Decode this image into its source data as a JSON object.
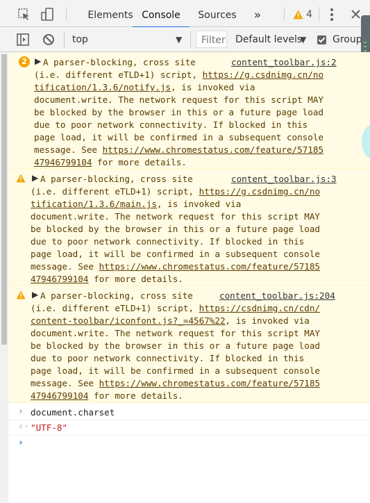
{
  "tabs": [
    {
      "label": "Elements"
    },
    {
      "label": "Console"
    },
    {
      "label": "Sources"
    }
  ],
  "tabs_more": "»",
  "warning_count": "4",
  "toolbar": {
    "context": "top",
    "filter_placeholder": "Filter",
    "levels": "Default levels",
    "group_label": "Group"
  },
  "messages": [
    {
      "count": "2",
      "source": "content_toolbar.js:2",
      "lines": [
        "A parser-blocking, cross site",
        "(i.e. different eTLD+1) script, ",
        "tification/1.3.6/notify.js",
        ", is invoked via",
        "document.write. The network request for this script MAY",
        "be blocked by the browser in this or a future page load",
        "due to poor network connectivity. If blocked in this",
        "page load, it will be confirmed in a subsequent console",
        "message. See ",
        "47946799104",
        " for more details."
      ],
      "url1a": "https://g.csdnimg.cn/no",
      "url2a": "https://www.chromestatus.com/feature/57185"
    },
    {
      "source": "content_toolbar.js:3",
      "lines": [
        "A parser-blocking, cross site",
        "(i.e. different eTLD+1) script, ",
        "tification/1.3.6/main.js",
        ", is invoked via",
        "document.write. The network request for this script MAY",
        "be blocked by the browser in this or a future page load",
        "due to poor network connectivity. If blocked in this",
        "page load, it will be confirmed in a subsequent console",
        "message. See ",
        "47946799104",
        " for more details."
      ],
      "url1a": "https://g.csdnimg.cn/no",
      "url2a": "https://www.chromestatus.com/feature/57185"
    },
    {
      "source": "content_toolbar.js:204",
      "lines": [
        "A parser-blocking, cross site",
        "(i.e. different eTLD+1) script, ",
        "content-toolbar/iconfont.js?_=4567%22",
        ", is invoked via",
        "document.write. The network request for this script MAY",
        "be blocked by the browser in this or a future page load",
        "due to poor network connectivity. If blocked in this",
        "page load, it will be confirmed in a subsequent console",
        "message. See ",
        "47946799104",
        " for more details."
      ],
      "url1a": "https://csdnimg.cn/cdn/",
      "url2a": "https://www.chromestatus.com/feature/57185"
    }
  ],
  "input_command": "document.charset",
  "result_value": "\"UTF-8\"",
  "colors": {
    "accent": "#1a73e8",
    "warning_bg": "#fffbe5",
    "warning_text": "#5c3c00",
    "string_value": "#c41a16"
  }
}
